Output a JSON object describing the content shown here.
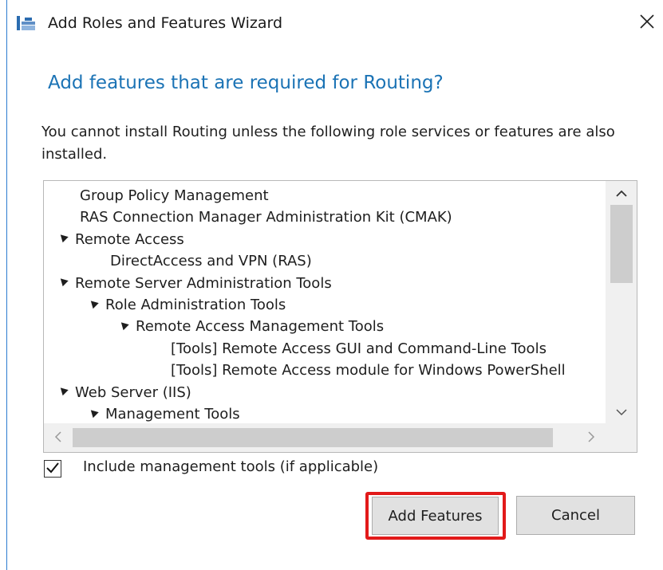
{
  "window": {
    "title": "Add Roles and Features Wizard",
    "close_glyph": "✕"
  },
  "dialog": {
    "heading": "Add features that are required for Routing?",
    "description": "You cannot install Routing unless the following role services or features are also installed."
  },
  "features_list": {
    "items": [
      {
        "label": "Group Policy Management",
        "level": 0,
        "expanded": false
      },
      {
        "label": "RAS Connection Manager Administration Kit (CMAK)",
        "level": 0,
        "expanded": false
      },
      {
        "label": "Remote Access",
        "level": 0,
        "expanded": true
      },
      {
        "label": "DirectAccess and VPN (RAS)",
        "level": 1,
        "expanded": false
      },
      {
        "label": "Remote Server Administration Tools",
        "level": 0,
        "expanded": true
      },
      {
        "label": "Role Administration Tools",
        "level": 1,
        "expanded": true
      },
      {
        "label": "Remote Access Management Tools",
        "level": 2,
        "expanded": true
      },
      {
        "label": "[Tools] Remote Access GUI and Command-Line Tools",
        "level": 3,
        "expanded": false
      },
      {
        "label": "[Tools] Remote Access module for Windows PowerShell",
        "level": 3,
        "expanded": false
      },
      {
        "label": "Web Server (IIS)",
        "level": 0,
        "expanded": true
      },
      {
        "label": "Management Tools",
        "level": 1,
        "expanded": true
      }
    ]
  },
  "options": {
    "include_tools_label": "Include management tools (if applicable)",
    "include_tools_checked": true
  },
  "buttons": {
    "add_features": "Add Features",
    "cancel": "Cancel"
  },
  "colors": {
    "heading": "#1b73b5",
    "highlight": "#e21a1a",
    "button_bg": "#e1e1e1"
  }
}
